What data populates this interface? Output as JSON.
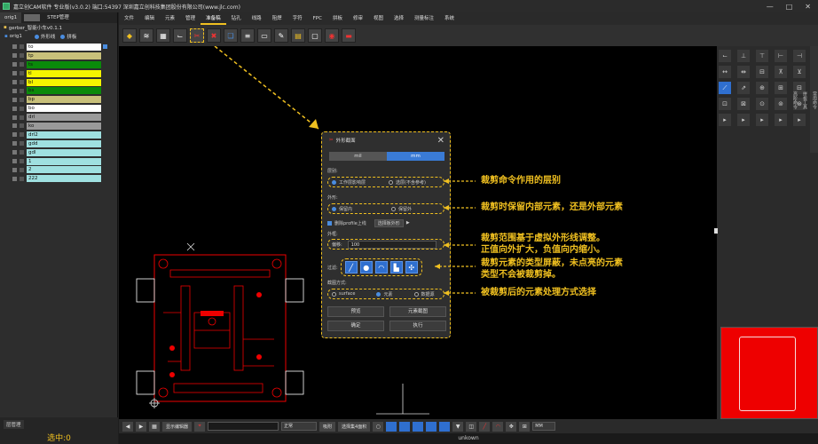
{
  "window": {
    "title": "嘉立创CAM软件 专业版(v3.0.2) 端口:54397      深圳嘉立创科技集团股份有限公司(www.jlc.com)",
    "controls": [
      "—",
      "□",
      "✕"
    ]
  },
  "left_panel": {
    "tabs": [
      "orig1",
      "STEP管理"
    ],
    "project_name": "gerber_智能小车v0.1.1",
    "step_name": "orig1",
    "outline_option": "外形线",
    "panel_option": "拼板",
    "layers": [
      {
        "name": "to",
        "color": "#ffffff"
      },
      {
        "name": "tp",
        "color": "#c8c07a"
      },
      {
        "name": "ts",
        "color": "#0a8a0a"
      },
      {
        "name": "tl",
        "color": "#f5f500"
      },
      {
        "name": "bl",
        "color": "#f5f500"
      },
      {
        "name": "bs",
        "color": "#0a8a0a"
      },
      {
        "name": "bp",
        "color": "#c8c07a"
      },
      {
        "name": "bo",
        "color": "#ffffff"
      },
      {
        "name": "drl",
        "color": "#9a9a9a"
      },
      {
        "name": "ko",
        "color": "#9a9a9a"
      },
      {
        "name": "drl2",
        "color": "#9fe0e0"
      },
      {
        "name": "gdd",
        "color": "#9fe0e0"
      },
      {
        "name": "gdl",
        "color": "#9fe0e0"
      },
      {
        "name": "1",
        "color": "#9fe0e0"
      },
      {
        "name": "2",
        "color": "#9fe0e0"
      },
      {
        "name": "222",
        "color": "#9fe0e0"
      }
    ],
    "manager_label": "层管理",
    "selected_label": "选中:0"
  },
  "menu": {
    "items": [
      "文件",
      "编辑",
      "元素",
      "管理",
      "准备稿",
      "钻孔",
      "线路",
      "阻焊",
      "字符",
      "FPC",
      "拼板",
      "修审",
      "视图",
      "选择",
      "测量标注",
      "系统"
    ],
    "active_index": 4
  },
  "dialog": {
    "title": "外形截面",
    "units": [
      "mil",
      "mm"
    ],
    "active_unit": "mm",
    "layer_label": "层别:",
    "layer_options": [
      "工作层影响层",
      "选层(不含参考)"
    ],
    "keep_label": "外形:",
    "keep_options": [
      "保留内",
      "保留外"
    ],
    "delete_profile_label": "删除profile上线",
    "select_profile_label": "选择板外形",
    "outline_label": "外框:",
    "offset_label": "偏移:",
    "offset_value": "100",
    "filter_label": "过滤:",
    "filter_icons": [
      "line-icon",
      "pad-icon",
      "arc-icon",
      "surface-icon",
      "text-icon"
    ],
    "mode_label": "截图方式:",
    "mode_options": [
      "surface",
      "元素",
      "数据源"
    ],
    "buttons": [
      "预览",
      "元素截图",
      "确定",
      "执行"
    ]
  },
  "annotations": [
    "裁剪命令作用的层别",
    "裁剪时保留内部元素，还是外部元素",
    "裁剪范围基于虚拟外形线调整。",
    "正值向外扩大，负值向内缩小。",
    "裁剪元素的类型屏蔽，未点亮的元素",
    "类型不会被裁剪掉。",
    "被裁剪后的元素处理方式选择"
  ],
  "bottom_bar": {
    "show_editor": "显示编辑器",
    "mode_select": "正常",
    "snap_label": "吸附",
    "select_mode": "选择集4面积",
    "unit_select": "MM"
  },
  "status": {
    "text": "unkown"
  },
  "colors": {
    "accent": "#f0c020",
    "selection_blue": "#2f6fcf",
    "pcb_red": "#e00000"
  }
}
